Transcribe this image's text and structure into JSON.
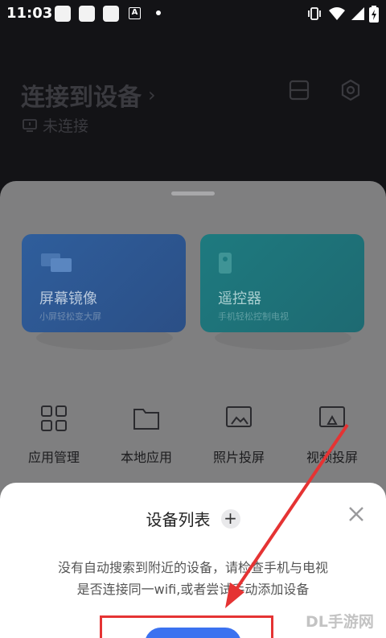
{
  "status_bar": {
    "time": "11:03",
    "notif_letter": "A"
  },
  "header": {
    "title": "连接到设备",
    "title_chevron": "›",
    "connection_status": "未连接",
    "icons": [
      "scan-icon",
      "settings-icon"
    ]
  },
  "cards": [
    {
      "title": "屏幕镜像",
      "subtitle": "小屏轻松变大屏",
      "icon": "screen-mirror-icon",
      "color": "#2f5e9c"
    },
    {
      "title": "遥控器",
      "subtitle": "手机轻松控制电视",
      "icon": "remote-icon",
      "color": "#1e7a7f"
    }
  ],
  "grid": [
    {
      "label": "应用管理",
      "icon": "apps-grid-icon"
    },
    {
      "label": "本地应用",
      "icon": "folder-icon"
    },
    {
      "label": "照片投屏",
      "icon": "photo-cast-icon"
    },
    {
      "label": "视频投屏",
      "icon": "video-cast-icon"
    }
  ],
  "dialog": {
    "title": "设备列表",
    "plus": "+",
    "message_line1": "没有自动搜索到附近的设备，请检查手机与电视",
    "message_line2": "是否连接同一wifi,或者尝试手动添加设备",
    "accent": "#3b72f0"
  },
  "annotation": {
    "arrow_color": "#e53333"
  },
  "watermark": "DL手游网"
}
